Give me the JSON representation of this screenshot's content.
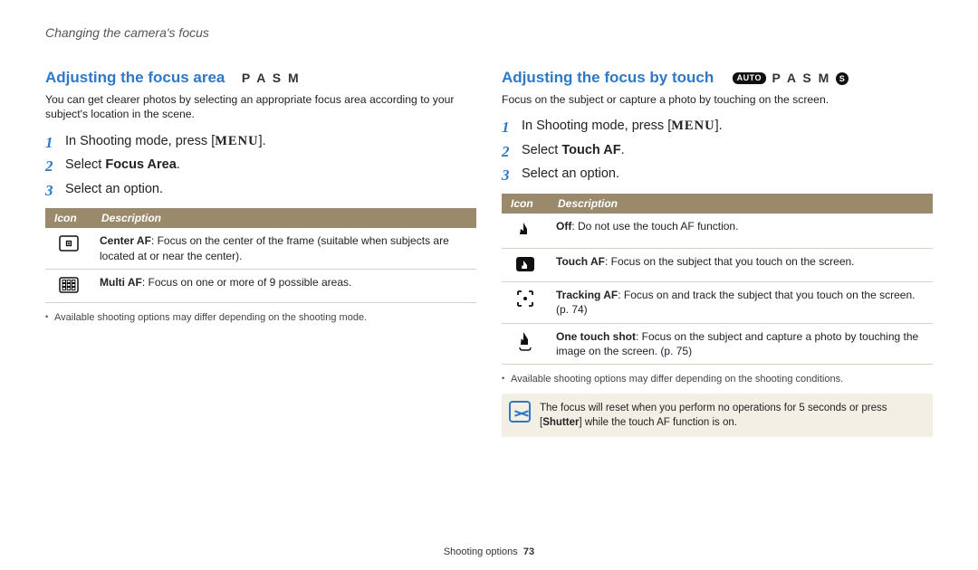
{
  "header": {
    "breadcrumb": "Changing the camera's focus"
  },
  "left": {
    "title": "Adjusting the focus area",
    "modes_text": "P A S M",
    "intro": "You can get clearer photos by selecting an appropriate focus area according to your subject's location in the scene.",
    "steps": {
      "s1_pre": "In Shooting mode, press [",
      "s1_menu": "MENU",
      "s1_post": "].",
      "s2_pre": "Select ",
      "s2_bold": "Focus Area",
      "s2_post": ".",
      "s3": "Select an option."
    },
    "table": {
      "col_icon": "Icon",
      "col_desc": "Description",
      "rows": [
        {
          "icon": "center-af-icon",
          "bold": "Center AF",
          "rest": ": Focus on the center of the frame (suitable when subjects are located at or near the center)."
        },
        {
          "icon": "multi-af-icon",
          "bold": "Multi AF",
          "rest": ": Focus on one or more of 9 possible areas."
        }
      ]
    },
    "footnote": "Available shooting options may differ depending on the shooting mode."
  },
  "right": {
    "title": "Adjusting the focus by touch",
    "mode_auto_label": "AUTO",
    "modes_text": "P A S M",
    "mode_s_label": "S",
    "intro": "Focus on the subject or capture a photo by touching on the screen.",
    "steps": {
      "s1_pre": "In Shooting mode, press [",
      "s1_menu": "MENU",
      "s1_post": "].",
      "s2_pre": "Select ",
      "s2_bold": "Touch AF",
      "s2_post": ".",
      "s3": "Select an option."
    },
    "table": {
      "col_icon": "Icon",
      "col_desc": "Description",
      "rows": [
        {
          "icon": "off-icon",
          "bold": "Off",
          "rest": ": Do not use the touch AF function."
        },
        {
          "icon": "touch-af-icon",
          "bold": "Touch AF",
          "rest": ": Focus on the subject that you touch on the screen."
        },
        {
          "icon": "tracking-af-icon",
          "bold": "Tracking AF",
          "rest": ": Focus on and track the subject that you touch on the screen. (p. 74)"
        },
        {
          "icon": "one-touch-shot-icon",
          "bold": "One touch shot",
          "rest": ": Focus on the subject and capture a photo by touching the image on the screen. (p. 75)"
        }
      ]
    },
    "footnote": "Available shooting options may differ depending on the shooting conditions.",
    "callout_pre": "The focus will reset when you perform no operations for 5 seconds or press [",
    "callout_bold": "Shutter",
    "callout_post": "] while the touch AF function is on."
  },
  "footer": {
    "section": "Shooting options",
    "page": "73"
  }
}
